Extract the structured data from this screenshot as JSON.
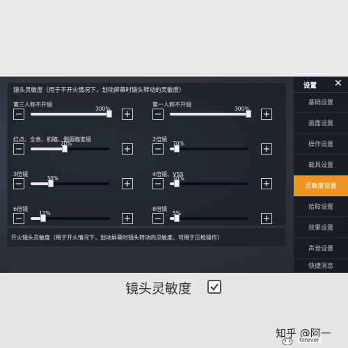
{
  "main": {
    "section_title": "镜头灵敏度（用于不开火情况下，划动屏幕时镜头转动的灵敏度）",
    "sliders": [
      {
        "label": "第三人称不开镜",
        "value": "300%",
        "fraction": 1.0
      },
      {
        "label": "第一人称不开镜",
        "value": "300%",
        "fraction": 1.0
      },
      {
        "label": "红点、全息、机瞄、侧面瞄准镜",
        "value": "70%",
        "fraction": 0.43
      },
      {
        "label": "2倍镜",
        "value": "70%",
        "fraction": 0.09
      },
      {
        "label": "3倍镜",
        "value": "30%",
        "fraction": 0.26
      },
      {
        "label": "4倍镜、VSS",
        "value": "30%",
        "fraction": 0.09
      },
      {
        "label": "6倍镜",
        "value": "12%",
        "fraction": 0.16
      },
      {
        "label": "8倍镜",
        "value": "5%",
        "fraction": 0.09
      }
    ],
    "firing_title": "开火镜头灵敏度（用于开火情况下，划动屏幕时镜头转动的灵敏度，可用于压枪操作）"
  },
  "sidebar": {
    "title": "设置",
    "close": "✕",
    "items": [
      {
        "label": "基础设置"
      },
      {
        "label": "画面设置"
      },
      {
        "label": "操作设置"
      },
      {
        "label": "载具设置"
      },
      {
        "label": "灵敏度设置"
      },
      {
        "label": "拾取设置"
      },
      {
        "label": "效果设置"
      },
      {
        "label": "声音设置"
      },
      {
        "label": "快捷消息"
      }
    ],
    "active_index": 4,
    "accent": "#e89521"
  },
  "buttons": {
    "minus": "−",
    "plus": "+"
  },
  "caption": {
    "text": "镜头灵敏度"
  },
  "watermark": {
    "text": "知乎 @阿一",
    "sub": "forever"
  }
}
